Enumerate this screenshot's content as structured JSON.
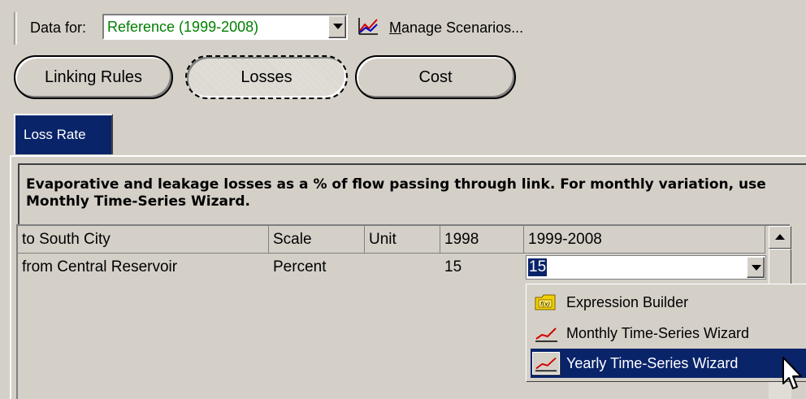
{
  "toolbar": {
    "data_for_label": "Data for:",
    "scenario_value": "Reference (1999-2008)",
    "manage_scenarios_label": "Manage Scenarios..."
  },
  "category_buttons": [
    {
      "label": "Linking Rules"
    },
    {
      "label": "Losses",
      "selected": true
    },
    {
      "label": "Cost"
    }
  ],
  "tabs": [
    {
      "label": "Loss Rate",
      "active": true
    }
  ],
  "description": "Evaporative and leakage losses as a % of flow passing through link.  For monthly variation, use Monthly Time-Series Wizard.",
  "grid": {
    "headers": [
      "to South City",
      "Scale",
      "Unit",
      "1998",
      "1999-2008"
    ],
    "rows": [
      {
        "name": "from Central Reservoir",
        "scale": "Percent",
        "unit": "",
        "v1998": "15",
        "v1999_2008": "15"
      }
    ]
  },
  "popup_menu": {
    "items": [
      {
        "label": "Expression Builder",
        "icon": "expression-builder-icon"
      },
      {
        "label": "Monthly Time-Series Wizard",
        "icon": "timeseries-icon"
      },
      {
        "label": "Yearly Time-Series Wizard",
        "icon": "timeseries-icon",
        "highlighted": true
      }
    ]
  },
  "colors": {
    "highlight": "#0a246a",
    "scenario_text": "#008000",
    "face": "#d4d0c8"
  }
}
